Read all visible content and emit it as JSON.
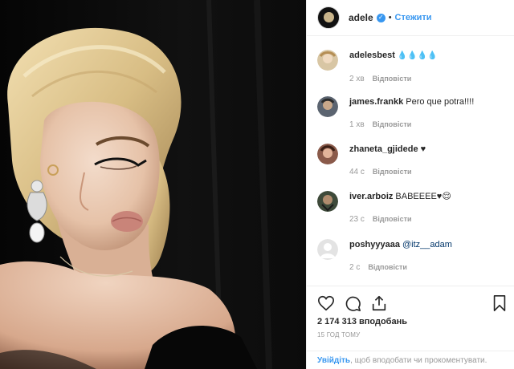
{
  "post": {
    "author": "adele",
    "follow_label": "Стежити",
    "separator": "•"
  },
  "comments": [
    {
      "user": "adelesbest",
      "text": "",
      "emoji": "💧💧💧💧",
      "time": "2 хв",
      "reply": "Відповісти",
      "avatar_color": "#d8c6a4"
    },
    {
      "user": "james.frankk",
      "text": "Pero que potra!!!!",
      "emoji": "",
      "time": "1 хв",
      "reply": "Відповісти",
      "avatar_color": "#5b6470"
    },
    {
      "user": "zhaneta_gjidede",
      "text": "",
      "emoji": "♥",
      "time": "44 с",
      "reply": "Відповісти",
      "avatar_color": "#8a5a4a"
    },
    {
      "user": "iver.arboiz",
      "text": "BABEEEE",
      "emoji": "♥😌",
      "time": "23 с",
      "reply": "Відповісти",
      "avatar_color": "#3e4a3a"
    },
    {
      "user": "poshyyyaaa",
      "text": "@itz__adam",
      "emoji": "",
      "time": "2 с",
      "reply": "Відповісти",
      "avatar_color": "#e3e3e3"
    }
  ],
  "stats": {
    "likes": "2 174 313 вподобань",
    "time_ago": "15 ГОД ТОМУ"
  },
  "login": {
    "link": "Увійдіть",
    "rest": ", щоб вподобати чи прокоментувати."
  },
  "icons": [
    "heart-icon",
    "comment-icon",
    "share-icon",
    "bookmark-icon"
  ],
  "colors": {
    "accent": "#3897f0",
    "text": "#262626",
    "muted": "#999999",
    "border": "#efefef"
  }
}
